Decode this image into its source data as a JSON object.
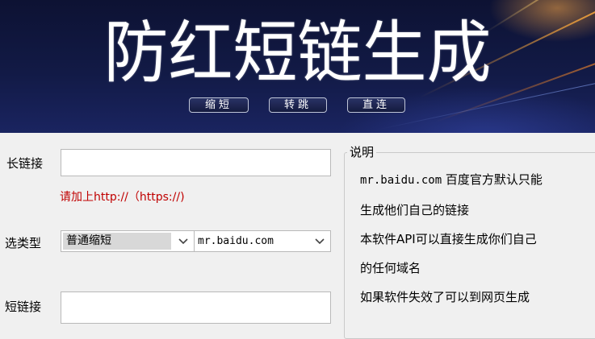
{
  "banner": {
    "title": "防红短链生成",
    "buttons": [
      "缩短",
      "转跳",
      "直连"
    ]
  },
  "form": {
    "long_url_label": "长链接",
    "long_url_value": "",
    "hint": "请加上http://（https://)",
    "type_label": "选类型",
    "type_value": "普通缩短",
    "domain_value": "mr.baidu.com",
    "short_url_label": "短链接",
    "short_url_value": ""
  },
  "info": {
    "title": "说明",
    "line1_domain": "mr.baidu.com",
    "line1_text": " 百度官方默认只能",
    "line2": "生成他们自己的链接",
    "line3": "本软件API可以直接生成你们自己",
    "line4": "的任何域名",
    "line5": "如果软件失效了可以到网页生成"
  },
  "colors": {
    "hint": "#c00000",
    "banner_bg": "#121a46"
  }
}
